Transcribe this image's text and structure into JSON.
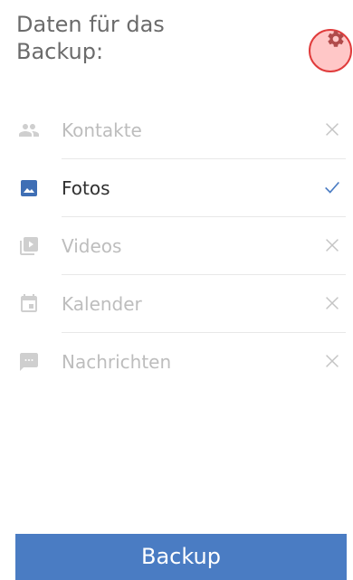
{
  "header": {
    "title": "Daten für das\nBackup:"
  },
  "items": [
    {
      "label": "Kontakte",
      "icon": "people-icon",
      "status": "excluded"
    },
    {
      "label": "Fotos",
      "icon": "photo-icon",
      "status": "selected"
    },
    {
      "label": "Videos",
      "icon": "video-icon",
      "status": "excluded"
    },
    {
      "label": "Kalender",
      "icon": "calendar-icon",
      "status": "excluded"
    },
    {
      "label": "Nachrichten",
      "icon": "message-icon",
      "status": "excluded"
    }
  ],
  "actions": {
    "backup_label": "Backup"
  },
  "colors": {
    "accent": "#4a7cc3",
    "muted": "#bdbdbd",
    "text": "#303030",
    "title": "#6b6b6b",
    "settings_highlight": "#ffc7c7"
  }
}
